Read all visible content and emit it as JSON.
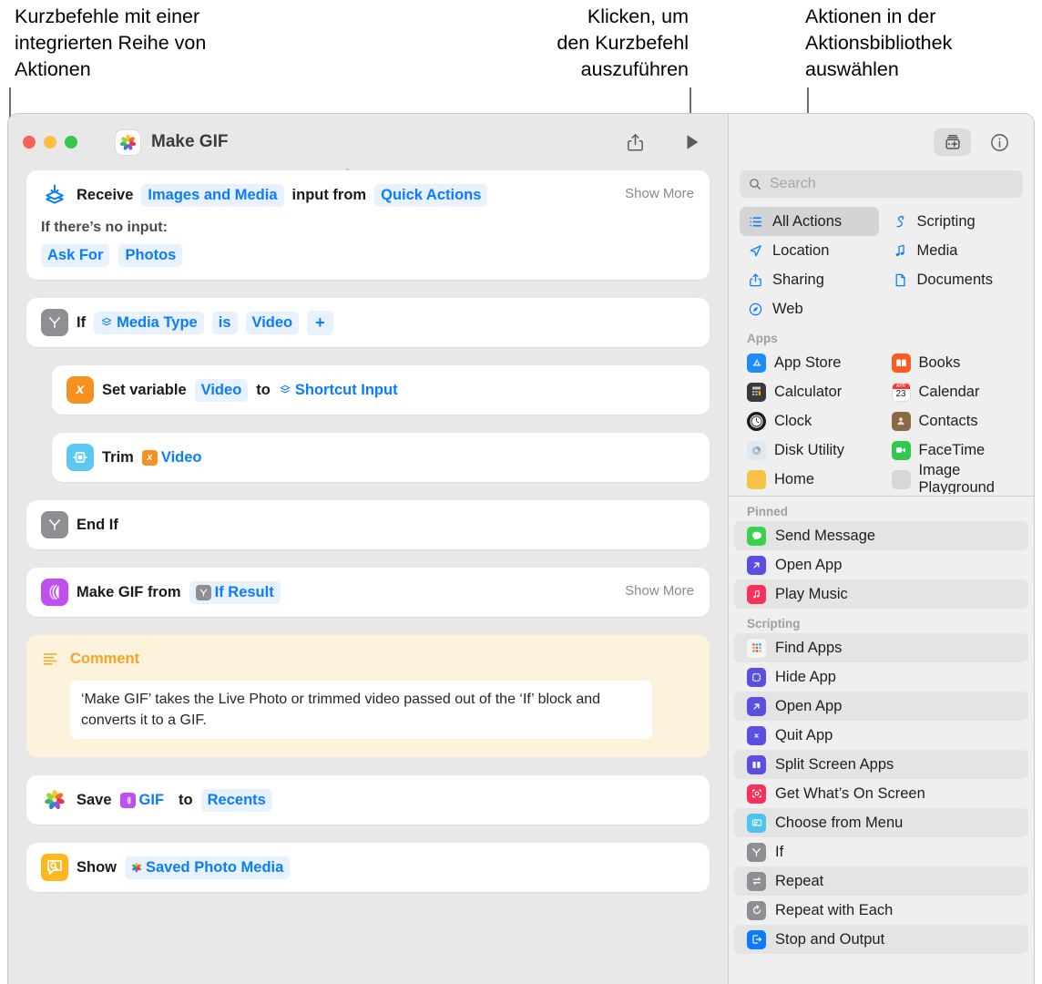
{
  "callouts": [
    {
      "id": "callout-1",
      "text": "Kurzbefehle mit einer\nintegrierten Reihe von\nAktionen"
    },
    {
      "id": "callout-2",
      "text": "Klicken, um\nden Kurzbefehl\nauszuführen"
    },
    {
      "id": "callout-3",
      "text": "Aktionen in der\nAktionsbibliothek\nauswählen"
    }
  ],
  "window": {
    "title": "Make GIF",
    "app_icon": "photos-icon",
    "traffic_lights": [
      "close",
      "minimize",
      "zoom"
    ],
    "toolbar": {
      "share_label": "share-icon",
      "run_label": "run-icon",
      "add_action_label": "add-action-icon",
      "info_label": "info-icon"
    }
  },
  "actions": [
    {
      "id": "receive",
      "icon": "receive-icon",
      "show_more": "Show More",
      "parts": [
        {
          "type": "text",
          "value": "Receive"
        },
        {
          "type": "token",
          "value": "Images and Media"
        },
        {
          "type": "text",
          "value": "input from"
        },
        {
          "type": "token",
          "value": "Quick Actions"
        }
      ],
      "sub_label": "If there’s no input:",
      "sub_tokens": [
        "Ask For",
        "Photos"
      ]
    },
    {
      "id": "if",
      "icon": "if-icon",
      "parts": [
        {
          "type": "text",
          "value": "If"
        },
        {
          "type": "token",
          "value": "Media Type",
          "badge": "shortcut-input-icon"
        },
        {
          "type": "token",
          "value": "is"
        },
        {
          "type": "token",
          "value": "Video"
        },
        {
          "type": "token",
          "value": "+"
        }
      ]
    },
    {
      "id": "set-variable",
      "icon": "set-variable-icon",
      "indent": true,
      "parts": [
        {
          "type": "text",
          "value": "Set variable"
        },
        {
          "type": "token",
          "value": "Video"
        },
        {
          "type": "text",
          "value": "to"
        },
        {
          "type": "token",
          "value": "Shortcut Input",
          "badge": "shortcut-input-icon",
          "plain": true
        }
      ]
    },
    {
      "id": "trim",
      "icon": "trim-icon",
      "indent": true,
      "parts": [
        {
          "type": "text",
          "value": "Trim"
        },
        {
          "type": "token",
          "value": "Video",
          "badge": "variable-icon",
          "plain": true
        }
      ]
    },
    {
      "id": "end-if",
      "icon": "if-icon",
      "parts": [
        {
          "type": "text",
          "value": "End If"
        }
      ]
    },
    {
      "id": "make-gif",
      "icon": "make-gif-icon",
      "show_more": "Show More",
      "parts": [
        {
          "type": "text",
          "value": "Make GIF from"
        },
        {
          "type": "token",
          "value": "If Result",
          "badge": "if-badge"
        }
      ]
    }
  ],
  "comment": {
    "icon": "comment-icon",
    "title": "Comment",
    "body": "‘Make GIF’ takes the Live Photo or trimmed video passed out of the ‘If’ block and converts it to a GIF."
  },
  "actions_bottom": [
    {
      "id": "save",
      "icon": "photos-icon",
      "parts": [
        {
          "type": "text",
          "value": "Save"
        },
        {
          "type": "token",
          "value": "GIF",
          "badge": "gif-badge"
        },
        {
          "type": "text",
          "value": "to"
        },
        {
          "type": "token",
          "value": "Recents"
        }
      ]
    },
    {
      "id": "show",
      "icon": "show-icon",
      "parts": [
        {
          "type": "text",
          "value": "Show"
        },
        {
          "type": "token",
          "value": "Saved Photo Media",
          "badge": "photos-dot"
        }
      ]
    }
  ],
  "sidebar": {
    "search": {
      "placeholder": "Search",
      "value": "",
      "icon": "search-icon"
    },
    "categories": [
      {
        "label": "All Actions",
        "icon": "list-icon",
        "selected": true
      },
      {
        "label": "Scripting",
        "icon": "scripting-icon",
        "selected": false
      },
      {
        "label": "Location",
        "icon": "location-icon",
        "selected": false
      },
      {
        "label": "Media",
        "icon": "media-icon",
        "selected": false
      },
      {
        "label": "Sharing",
        "icon": "share-icon",
        "selected": false
      },
      {
        "label": "Documents",
        "icon": "document-icon",
        "selected": false
      },
      {
        "label": "Web",
        "icon": "web-icon",
        "selected": false
      }
    ],
    "apps_header": "Apps",
    "apps": [
      {
        "label": "App Store",
        "icon": "app-store-icon",
        "color": "#1d8df5"
      },
      {
        "label": "Books",
        "icon": "books-icon",
        "color": "#ff5a1f"
      },
      {
        "label": "Calculator",
        "icon": "calculator-icon",
        "color": "#2f2f32"
      },
      {
        "label": "Calendar",
        "icon": "calendar-icon",
        "color": "#ffffff"
      },
      {
        "label": "Clock",
        "icon": "clock-icon",
        "color": "#1b1b1d"
      },
      {
        "label": "Contacts",
        "icon": "contacts-icon",
        "color": "#8a6a44"
      },
      {
        "label": "Disk Utility",
        "icon": "disk-utility-icon",
        "color": "#c8d6e2"
      },
      {
        "label": "FaceTime",
        "icon": "facetime-icon",
        "color": "#30c94f"
      }
    ],
    "pinned_header": "Pinned",
    "pinned": [
      {
        "label": "Send Message",
        "icon": "messages-icon",
        "color": "#3ad14d"
      },
      {
        "label": "Open App",
        "icon": "open-app-icon",
        "color": "#5a4fe0"
      },
      {
        "label": "Play Music",
        "icon": "music-icon",
        "color": "#f8315a"
      }
    ],
    "scripting_header": "Scripting",
    "scripting": [
      {
        "label": "Find Apps",
        "icon": "find-apps-icon",
        "color": "#f2f2f2"
      },
      {
        "label": "Hide App",
        "icon": "hide-app-icon",
        "color": "#5a4fe0"
      },
      {
        "label": "Open App",
        "icon": "open-app-icon",
        "color": "#5a4fe0"
      },
      {
        "label": "Quit App",
        "icon": "quit-app-icon",
        "color": "#5a4fe0"
      },
      {
        "label": "Split Screen Apps",
        "icon": "split-screen-icon",
        "color": "#5a4fe0"
      },
      {
        "label": "Get What’s On Screen",
        "icon": "get-screen-icon",
        "color": "#f8315a"
      },
      {
        "label": "Choose from Menu",
        "icon": "choose-menu-icon",
        "color": "#4ec3f0"
      },
      {
        "label": "If",
        "icon": "if-icon",
        "color": "#8e8e93"
      },
      {
        "label": "Repeat",
        "icon": "repeat-icon",
        "color": "#8e8e93"
      },
      {
        "label": "Repeat with Each",
        "icon": "repeat-each-icon",
        "color": "#8e8e93"
      },
      {
        "label": "Stop and Output",
        "icon": "stop-output-icon",
        "color": "#0a7cff"
      }
    ]
  },
  "colors": {
    "accent_blue": "#0a7cff",
    "token_bg": "#e8f1fe",
    "comment_bg": "#fdf3dd",
    "comment_accent": "#f5a623",
    "window_bg": "#e8e8e8",
    "sidebar_bg": "#efefef"
  }
}
